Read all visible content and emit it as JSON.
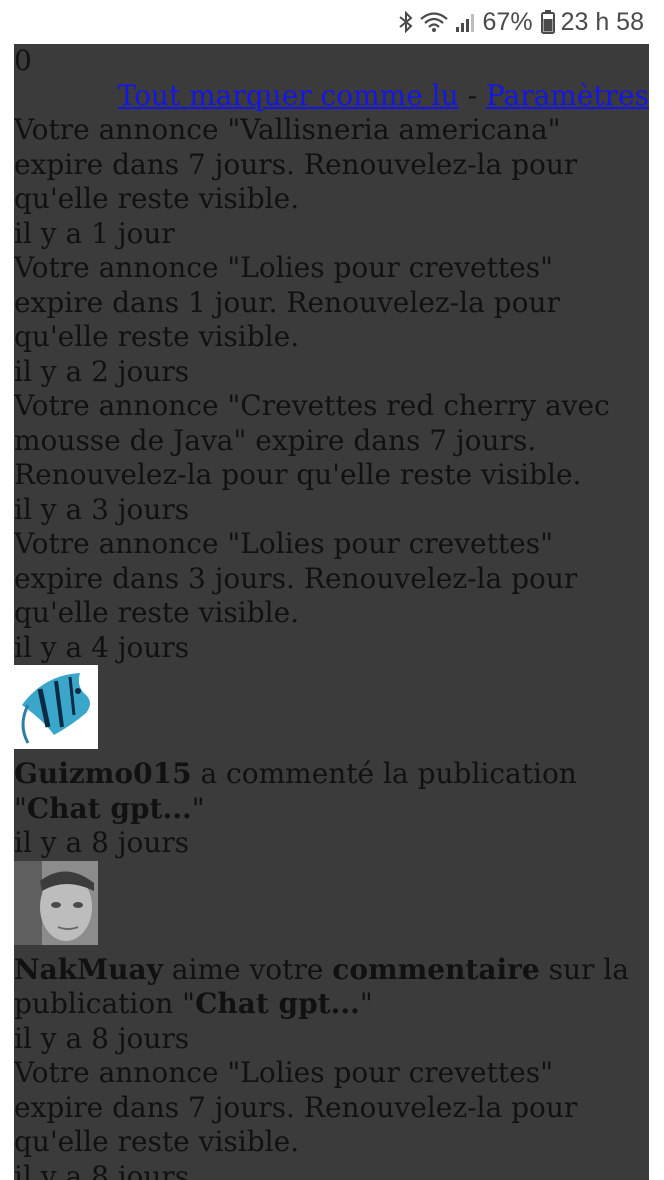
{
  "status_bar": {
    "battery": "67%",
    "time": "23 h 58",
    "icons": [
      "bluetooth-icon",
      "wifi-icon",
      "signal-icon",
      "battery-icon"
    ]
  },
  "page": {
    "counter": "0",
    "mark_all_read": "Tout marquer comme lu",
    "separator": "-",
    "settings": "Paramètres",
    "link_color": "#1515e8",
    "background": "#3b3b3b"
  },
  "notifications": [
    {
      "text": "Votre annonce \"Vallisneria americana\" expire dans 7 jours. Renouvelez-la pour qu'elle reste visible.",
      "time": "il y a 1 jour"
    },
    {
      "text": "Votre annonce \"Lolies pour crevettes\" expire dans 1 jour. Renouvelez-la pour qu'elle reste visible.",
      "time": "il y a 2 jours"
    },
    {
      "text": "Votre annonce \"Crevettes red cherry avec mousse de Java\" expire dans 7 jours. Renouvelez-la pour qu'elle reste visible.",
      "time": "il y a 3 jours"
    },
    {
      "text": "Votre annonce \"Lolies pour crevettes\" expire dans 3 jours. Renouvelez-la pour qu'elle reste visible.",
      "time": "il y a 4 jours"
    },
    {
      "user": "Guizmo015",
      "action": " a commenté la publication ",
      "quote_open": "\"",
      "publication": "Chat gpt...",
      "quote_close": "\"",
      "time": "il y a 8 jours"
    },
    {
      "user": "NakMuay",
      "action": " aime votre ",
      "object": "commentaire",
      "action2": " sur la publication ",
      "quote_open": "\"",
      "publication": "Chat gpt...",
      "quote_close": "\"",
      "time": "il y a 8 jours"
    },
    {
      "text": "Votre annonce \"Lolies pour crevettes\" expire dans 7 jours. Renouvelez-la pour qu'elle reste visible.",
      "time": "il y a 8 jours"
    }
  ]
}
